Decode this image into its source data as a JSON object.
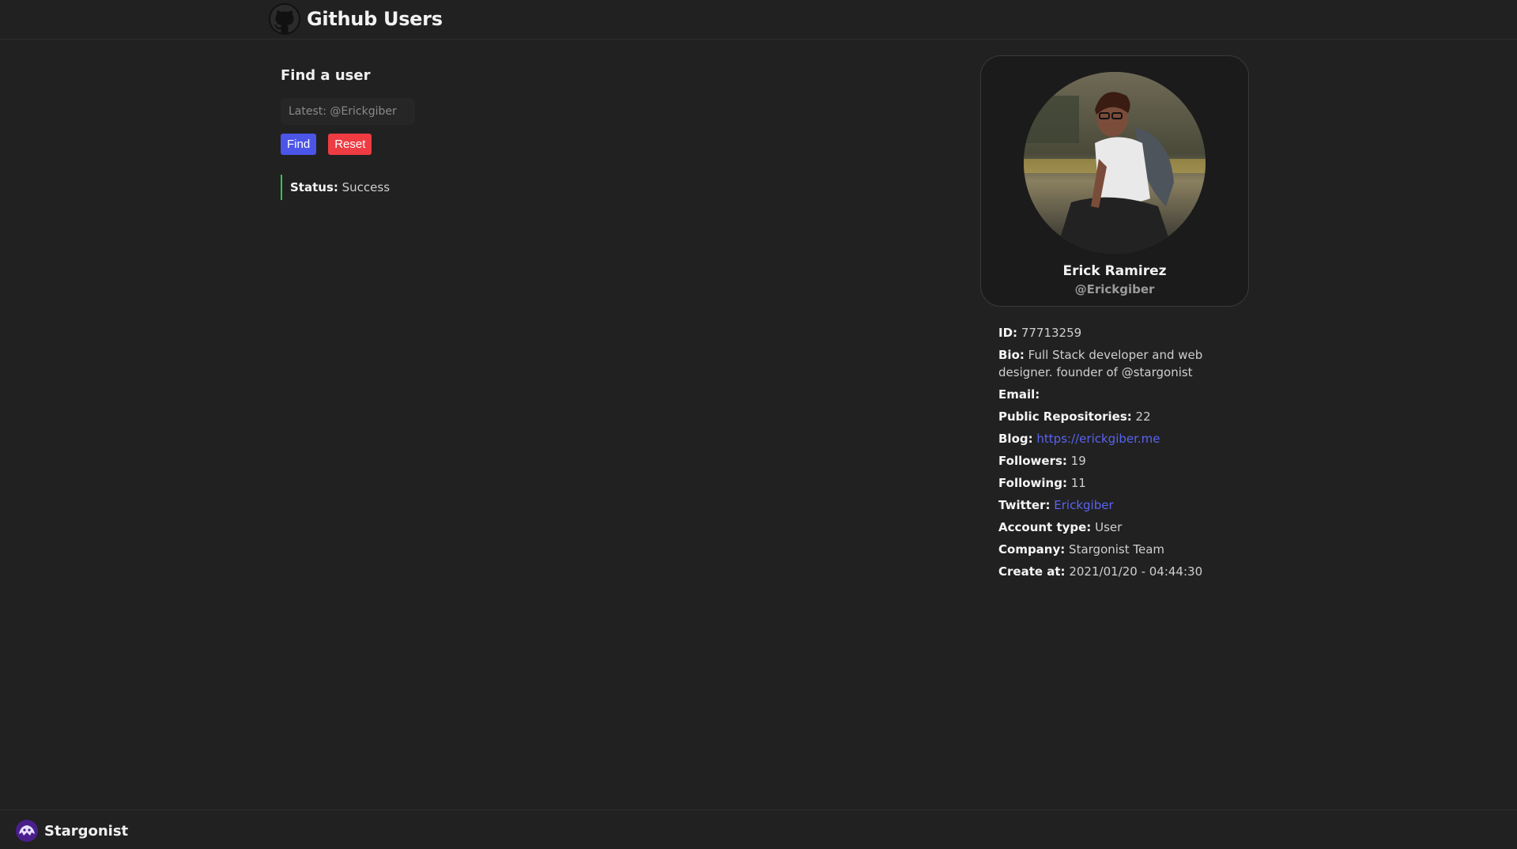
{
  "header": {
    "title": "Github Users",
    "logo_icon": "github-octocat-icon"
  },
  "finder": {
    "heading": "Find a user",
    "search_placeholder": "Latest: @Erickgiber",
    "search_value": "",
    "find_label": "Find",
    "reset_label": "Reset",
    "status_label": "Status:",
    "status_value": "Success",
    "status_color": "#2ecc40"
  },
  "profile": {
    "name": "Erick Ramirez",
    "login": "@Erickgiber",
    "details": {
      "id": {
        "label": "ID:",
        "value": "77713259"
      },
      "bio": {
        "label": "Bio:",
        "value": "Full Stack developer and web designer. founder of @stargonist"
      },
      "email": {
        "label": "Email:",
        "value": ""
      },
      "repos": {
        "label": "Public Repositories:",
        "value": "22"
      },
      "blog": {
        "label": "Blog:",
        "value": "https://erickgiber.me"
      },
      "followers": {
        "label": "Followers:",
        "value": "19"
      },
      "following": {
        "label": "Following:",
        "value": "11"
      },
      "twitter": {
        "label": "Twitter:",
        "value": "Erickgiber"
      },
      "account_type": {
        "label": "Account type:",
        "value": "User"
      },
      "company": {
        "label": "Company:",
        "value": "Stargonist Team"
      },
      "created": {
        "label": "Create at:",
        "value": "2021/01/20 - 04:44:30"
      }
    }
  },
  "footer": {
    "brand": "Stargonist",
    "brand_icon": "stargonist-logo-icon"
  },
  "colors": {
    "background": "#212121",
    "accent_blue": "#4b55e8",
    "danger_red": "#ef3b42",
    "link": "#5a63f2"
  }
}
